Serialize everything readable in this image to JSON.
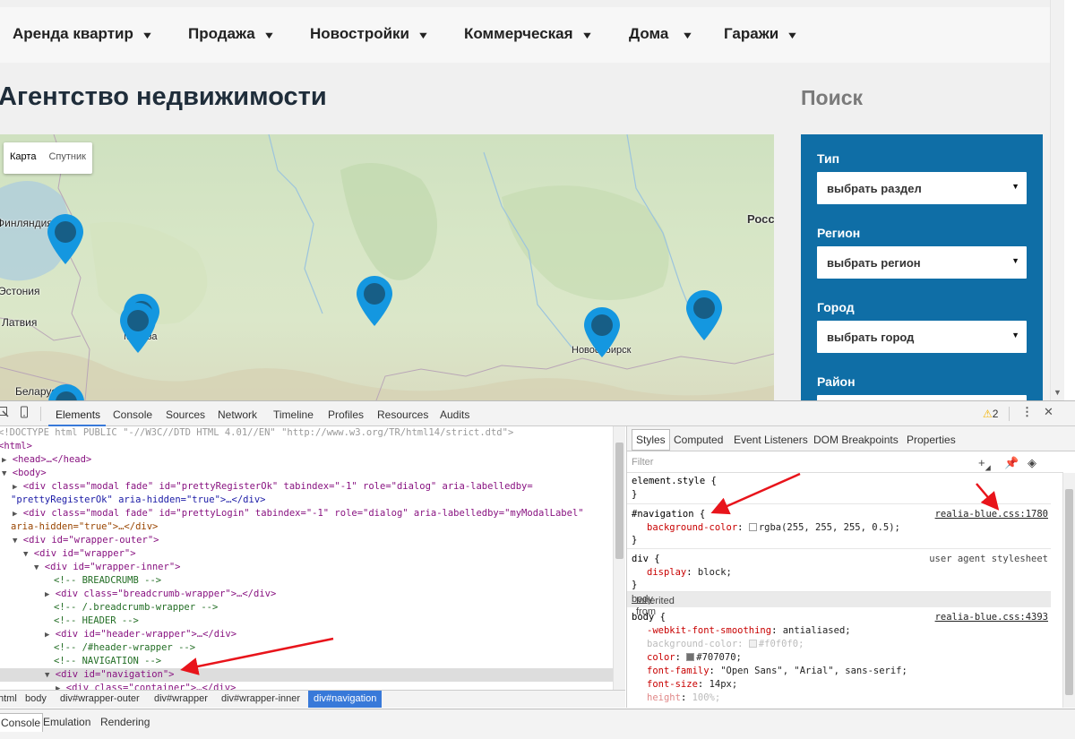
{
  "nav": {
    "items": [
      "Аренда квартир",
      "Продажа",
      "Новостройки",
      "Коммерческая",
      "Дома",
      "Гаражи"
    ],
    "chevron": "▼"
  },
  "site": {
    "title": "Агентство недвижимости",
    "search_title": "Поиск"
  },
  "map": {
    "buttons": [
      "Карта",
      "Спутник"
    ],
    "labels": [
      "Финляндия",
      "Эстония",
      "Латвия",
      "Беларусь",
      "Москва",
      "Новосибирск",
      "Росс"
    ],
    "pin_color": "#1497e0",
    "pin_dot_color": "#175e86"
  },
  "search": {
    "bg_color": "#0f6ea6",
    "fields": [
      {
        "label": "Тип",
        "value": "выбрать раздел"
      },
      {
        "label": "Регион",
        "value": "выбрать регион"
      },
      {
        "label": "Город",
        "value": "выбрать город"
      },
      {
        "label": "Район",
        "value": ""
      }
    ]
  },
  "devtools": {
    "tabs": [
      "Elements",
      "Console",
      "Sources",
      "Network",
      "Timeline",
      "Profiles",
      "Resources",
      "Audits"
    ],
    "active_tab": "Elements",
    "warning_count": "2",
    "elements": {
      "doctype": "<!DOCTYPE html PUBLIC \"-//W3C//DTD HTML 4.01//EN\" \"http://www.w3.org/TR/html14/strict.dtd\">",
      "html": "<html>",
      "head": "<head>…</head>",
      "body": "<body>",
      "modal1_line1": "<div class=\"modal fade\" id=\"prettyRegisterOk\" tabindex=\"-1\" role=\"dialog\" aria-labelledby=",
      "modal1_line2": "\"prettyRegisterOk\" aria-hidden=\"true\">…</div>",
      "modal2_line1": "<div class=\"modal fade\" id=\"prettyLogin\" tabindex=\"-1\" role=\"dialog\" aria-labelledby=\"myModalLabel\"",
      "modal2_line2": "aria-hidden=\"true\">…</div>",
      "wrapper_outer": "<div id=\"wrapper-outer\">",
      "wrapper": "<div id=\"wrapper\">",
      "wrapper_inner": "<div id=\"wrapper-inner\">",
      "c_breadcrumb": "<!-- BREADCRUMB -->",
      "breadcrumb_wrapper": "<div class=\"breadcrumb-wrapper\">…</div>",
      "c_breadcrumb_end": "<!-- /.breadcrumb-wrapper -->",
      "c_header": "<!-- HEADER -->",
      "header_wrapper": "<div id=\"header-wrapper\">…</div>",
      "c_header_end": "<!-- /#header-wrapper -->",
      "c_navigation": "<!-- NAVIGATION -->",
      "navigation": "<div id=\"navigation\">",
      "container": "<div class=\"container\">…</div>"
    },
    "breadcrumbs": [
      "html",
      "body",
      "div#wrapper-outer",
      "div#wrapper",
      "div#wrapper-inner",
      "div#navigation"
    ],
    "styles_tabs": [
      "Styles",
      "Computed",
      "Event Listeners",
      "DOM Breakpoints",
      "Properties"
    ],
    "filter_placeholder": "Filter",
    "rules": {
      "element_style": "element.style {",
      "close": "}",
      "nav_selector": "#navigation {",
      "nav_prop": "background-color",
      "nav_val": "rgba(255, 255, 255, 0.5);",
      "nav_src": "realia-blue.css:1780",
      "div_selector": "div {",
      "div_prop": "display",
      "div_val": "block;",
      "div_src": "user agent stylesheet",
      "inherited_label": "Inherited from",
      "inherited_from": "body",
      "body_selector": "body {",
      "body_src": "realia-blue.css:4393",
      "body_props": [
        {
          "p": "-webkit-font-smoothing",
          "v": "antialiased;"
        },
        {
          "p": "background-color",
          "v": "#f0f0f0;"
        },
        {
          "p": "color",
          "v": "#707070;"
        },
        {
          "p": "font-family",
          "v": "\"Open Sans\", \"Arial\", sans-serif;"
        },
        {
          "p": "font-size",
          "v": "14px;"
        },
        {
          "p": "height",
          "v": "100%;"
        }
      ]
    },
    "drawer_tabs": [
      "Console",
      "Emulation",
      "Rendering"
    ],
    "arrow_color": "#e8141b"
  }
}
